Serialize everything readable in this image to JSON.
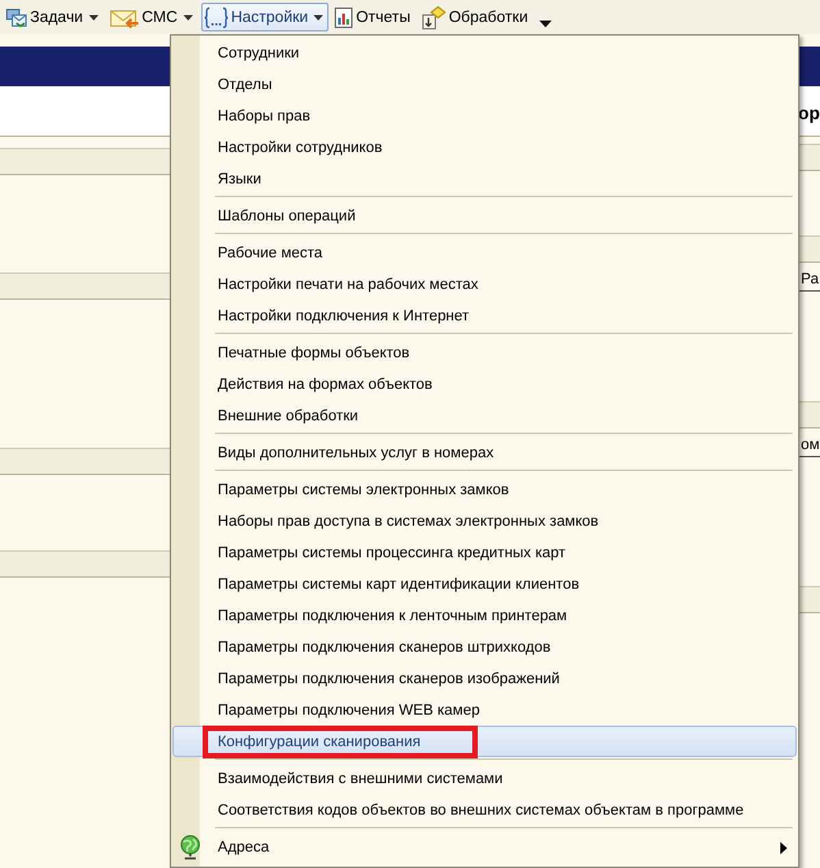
{
  "toolbar": {
    "items": [
      {
        "label": "Задачи",
        "dropdown": true,
        "selected": false
      },
      {
        "label": "СМС",
        "dropdown": true,
        "selected": false
      },
      {
        "label": "Настройки",
        "dropdown": true,
        "selected": true
      },
      {
        "label": "Отчеты",
        "dropdown": false,
        "selected": false
      },
      {
        "label": "Обработки",
        "dropdown": false,
        "selected": false
      }
    ]
  },
  "background": {
    "heading_fragment": "ор",
    "column_fragments": [
      "Ра",
      "ом"
    ]
  },
  "menu": {
    "groups": [
      [
        {
          "label": "Сотрудники",
          "kind": "plain",
          "selected": false,
          "marked": false,
          "submenu": false
        },
        {
          "label": "Отделы",
          "kind": "plain",
          "selected": false,
          "marked": false,
          "submenu": false
        },
        {
          "label": "Наборы прав",
          "kind": "plain",
          "selected": false,
          "marked": false,
          "submenu": false
        },
        {
          "label": "Настройки сотрудников",
          "kind": "plain",
          "selected": false,
          "marked": false,
          "submenu": false
        },
        {
          "label": "Языки",
          "kind": "plain",
          "selected": false,
          "marked": false,
          "submenu": false
        }
      ],
      [
        {
          "label": "Шаблоны операций",
          "kind": "plain",
          "selected": false,
          "marked": false,
          "submenu": false
        }
      ],
      [
        {
          "label": "Рабочие места",
          "kind": "plain",
          "selected": false,
          "marked": false,
          "submenu": false
        },
        {
          "label": "Настройки печати на рабочих местах",
          "kind": "plain",
          "selected": false,
          "marked": false,
          "submenu": false
        },
        {
          "label": "Настройки подключения к Интернет",
          "kind": "plain",
          "selected": false,
          "marked": false,
          "submenu": false
        }
      ],
      [
        {
          "label": "Печатные формы объектов",
          "kind": "plain",
          "selected": false,
          "marked": false,
          "submenu": false
        },
        {
          "label": "Действия на формах объектов",
          "kind": "plain",
          "selected": false,
          "marked": false,
          "submenu": false
        },
        {
          "label": "Внешние обработки",
          "kind": "plain",
          "selected": false,
          "marked": false,
          "submenu": false
        }
      ],
      [
        {
          "label": "Виды дополнительных услуг в номерах",
          "kind": "plain",
          "selected": false,
          "marked": false,
          "submenu": false
        }
      ],
      [
        {
          "label": "Параметры системы электронных замков",
          "kind": "plain",
          "selected": false,
          "marked": false,
          "submenu": false
        },
        {
          "label": "Наборы прав доступа в системах электронных замков",
          "kind": "plain",
          "selected": false,
          "marked": false,
          "submenu": false
        },
        {
          "label": "Параметры системы процессинга кредитных карт",
          "kind": "plain",
          "selected": false,
          "marked": false,
          "submenu": false
        },
        {
          "label": "Параметры системы карт идентификации клиентов",
          "kind": "plain",
          "selected": false,
          "marked": false,
          "submenu": false
        },
        {
          "label": "Параметры подключения к ленточным принтерам",
          "kind": "plain",
          "selected": false,
          "marked": false,
          "submenu": false
        },
        {
          "label": "Параметры подключения сканеров штрихкодов",
          "kind": "plain",
          "selected": false,
          "marked": false,
          "submenu": false
        },
        {
          "label": "Параметры подключения сканеров изображений",
          "kind": "plain",
          "selected": false,
          "marked": false,
          "submenu": false
        },
        {
          "label": "Параметры подключения WEB камер",
          "kind": "plain",
          "selected": false,
          "marked": false,
          "submenu": false
        },
        {
          "label": "Конфигурации сканирования",
          "kind": "plain",
          "selected": true,
          "marked": true,
          "submenu": false
        }
      ],
      [
        {
          "label": "Взаимодействия с внешними системами",
          "kind": "plain",
          "selected": false,
          "marked": false,
          "submenu": false
        },
        {
          "label": "Соответствия кодов объектов во внешних системах объектам в программе",
          "kind": "plain",
          "selected": false,
          "marked": false,
          "submenu": false
        }
      ],
      [
        {
          "label": "Адреса",
          "kind": "globe",
          "selected": false,
          "marked": false,
          "submenu": true
        }
      ]
    ]
  }
}
